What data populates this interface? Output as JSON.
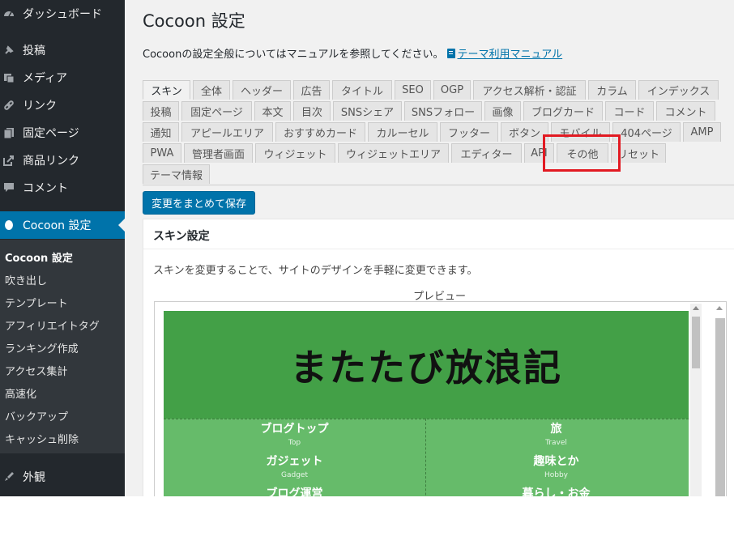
{
  "sidebar": {
    "top_items": [
      {
        "label": "ダッシュボード",
        "icon": "dashboard-icon"
      },
      {
        "label": "投稿",
        "icon": "pin-icon"
      },
      {
        "label": "メディア",
        "icon": "media-icon"
      },
      {
        "label": "リンク",
        "icon": "link-icon"
      },
      {
        "label": "固定ページ",
        "icon": "page-icon"
      },
      {
        "label": "商品リンク",
        "icon": "external-icon"
      },
      {
        "label": "コメント",
        "icon": "comment-icon"
      }
    ],
    "active_item": {
      "label": "Cocoon 設定",
      "icon": "cocoon-icon"
    },
    "submenu": [
      "Cocoon 設定",
      "吹き出し",
      "テンプレート",
      "アフィリエイトタグ",
      "ランキング作成",
      "アクセス集計",
      "高速化",
      "バックアップ",
      "キャッシュ削除"
    ],
    "appearance": {
      "label": "外観",
      "icon": "brush-icon"
    }
  },
  "main": {
    "title": "Cocoon 設定",
    "description": "Cocoonの設定全般についてはマニュアルを参照してください。",
    "manual_link": "テーマ利用マニュアル",
    "tabs_row1": [
      "スキン",
      "全体",
      "ヘッダー",
      "広告",
      "タイトル",
      "SEO",
      "OGP",
      "アクセス解析・認証",
      "カラム",
      "インデックス"
    ],
    "tabs_row2": [
      "投稿",
      "固定ページ",
      "本文",
      "目次",
      "SNSシェア",
      "SNSフォロー",
      "画像",
      "ブログカード",
      "コード",
      "コメント"
    ],
    "tabs_row3": [
      "通知",
      "アピールエリア",
      "おすすめカード",
      "カルーセル",
      "フッター",
      "ボタン",
      "モバイル",
      "404ページ",
      "AMP"
    ],
    "tabs_row4": [
      "PWA",
      "管理者画面",
      "ウィジェット",
      "ウィジェットエリア",
      "エディター",
      "API",
      "その他",
      "リセット"
    ],
    "tabs_row5": [
      "テーマ情報"
    ],
    "save_button": "変更をまとめて保存",
    "skin_title": "スキン設定",
    "skin_desc": "スキンを変更することで、サイトのデザインを手軽に変更できます。",
    "preview_label": "プレビュー",
    "preview": {
      "logo": "またたび放浪記",
      "nav": [
        {
          "label": "ブログトップ",
          "sub": "Top"
        },
        {
          "label": "旅",
          "sub": "Travel"
        },
        {
          "label": "ガジェット",
          "sub": "Gadget"
        },
        {
          "label": "趣味とか",
          "sub": "Hobby"
        },
        {
          "label": "ブログ運営",
          "sub": ""
        },
        {
          "label": "暮らし・お金",
          "sub": ""
        }
      ]
    }
  },
  "colors": {
    "sidebar": "#23282d",
    "accent": "#0073aa",
    "highlight": "#e21a22",
    "preview_header": "#43a047",
    "preview_nav": "#66bb6a"
  }
}
